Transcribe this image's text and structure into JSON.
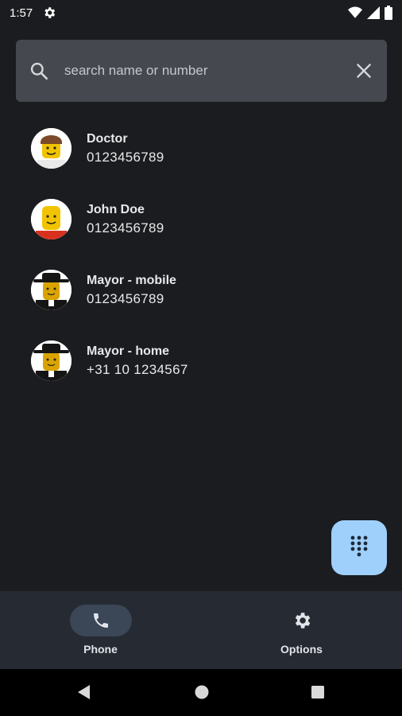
{
  "status_bar": {
    "time": "1:57",
    "icons": [
      "gear-icon",
      "wifi-icon",
      "signal-icon",
      "battery-icon"
    ]
  },
  "search": {
    "placeholder": "search name or number",
    "value": "",
    "icon": "search-icon",
    "clear_icon": "close-icon"
  },
  "contacts": [
    {
      "name": "Doctor",
      "number": "0123456789",
      "avatar": "lego-doctor"
    },
    {
      "name": "John Doe",
      "number": "0123456789",
      "avatar": "lego-john"
    },
    {
      "name": "Mayor - mobile",
      "number": "0123456789",
      "avatar": "lego-mayor"
    },
    {
      "name": "Mayor - home",
      "number": "+31 10 1234567",
      "avatar": "lego-mayor"
    }
  ],
  "fab": {
    "icon": "dialpad-icon"
  },
  "bottom_nav": {
    "items": [
      {
        "label": "Phone",
        "icon": "phone-icon",
        "active": true
      },
      {
        "label": "Options",
        "icon": "gear-icon",
        "active": false
      }
    ]
  },
  "system_nav": {
    "icons": [
      "back-icon",
      "home-icon",
      "recents-icon"
    ]
  },
  "colors": {
    "background": "#1b1c1f",
    "search_bg": "#45484e",
    "fab_bg": "#9fd0fb",
    "nav_bg": "#262b33",
    "nav_active_pill": "#3b4656"
  }
}
